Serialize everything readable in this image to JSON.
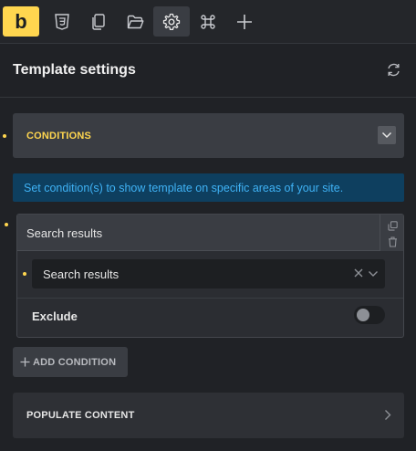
{
  "toolbar": {
    "logo_letter": "b",
    "icons": [
      "logo-icon",
      "css3-icon",
      "copy-pages-icon",
      "folder-icon",
      "gear-icon",
      "command-icon",
      "plus-icon"
    ],
    "active": "gear-icon",
    "accent": "#ffd64f"
  },
  "header": {
    "title": "Template settings",
    "reset_icon": "reset-icon"
  },
  "conditions": {
    "title": "CONDITIONS",
    "expanded": true,
    "info": "Set condition(s) to show template on specific areas of your site.",
    "items": [
      {
        "label": "Search results",
        "select_value": "Search results",
        "exclude_label": "Exclude",
        "exclude": false
      }
    ],
    "add_label": "ADD CONDITION"
  },
  "populate": {
    "label": "POPULATE CONTENT"
  },
  "colors": {
    "background": "#202226",
    "accent": "#ffd64f",
    "info_text": "#3fb2f5",
    "info_bg": "#0e3f5f"
  }
}
